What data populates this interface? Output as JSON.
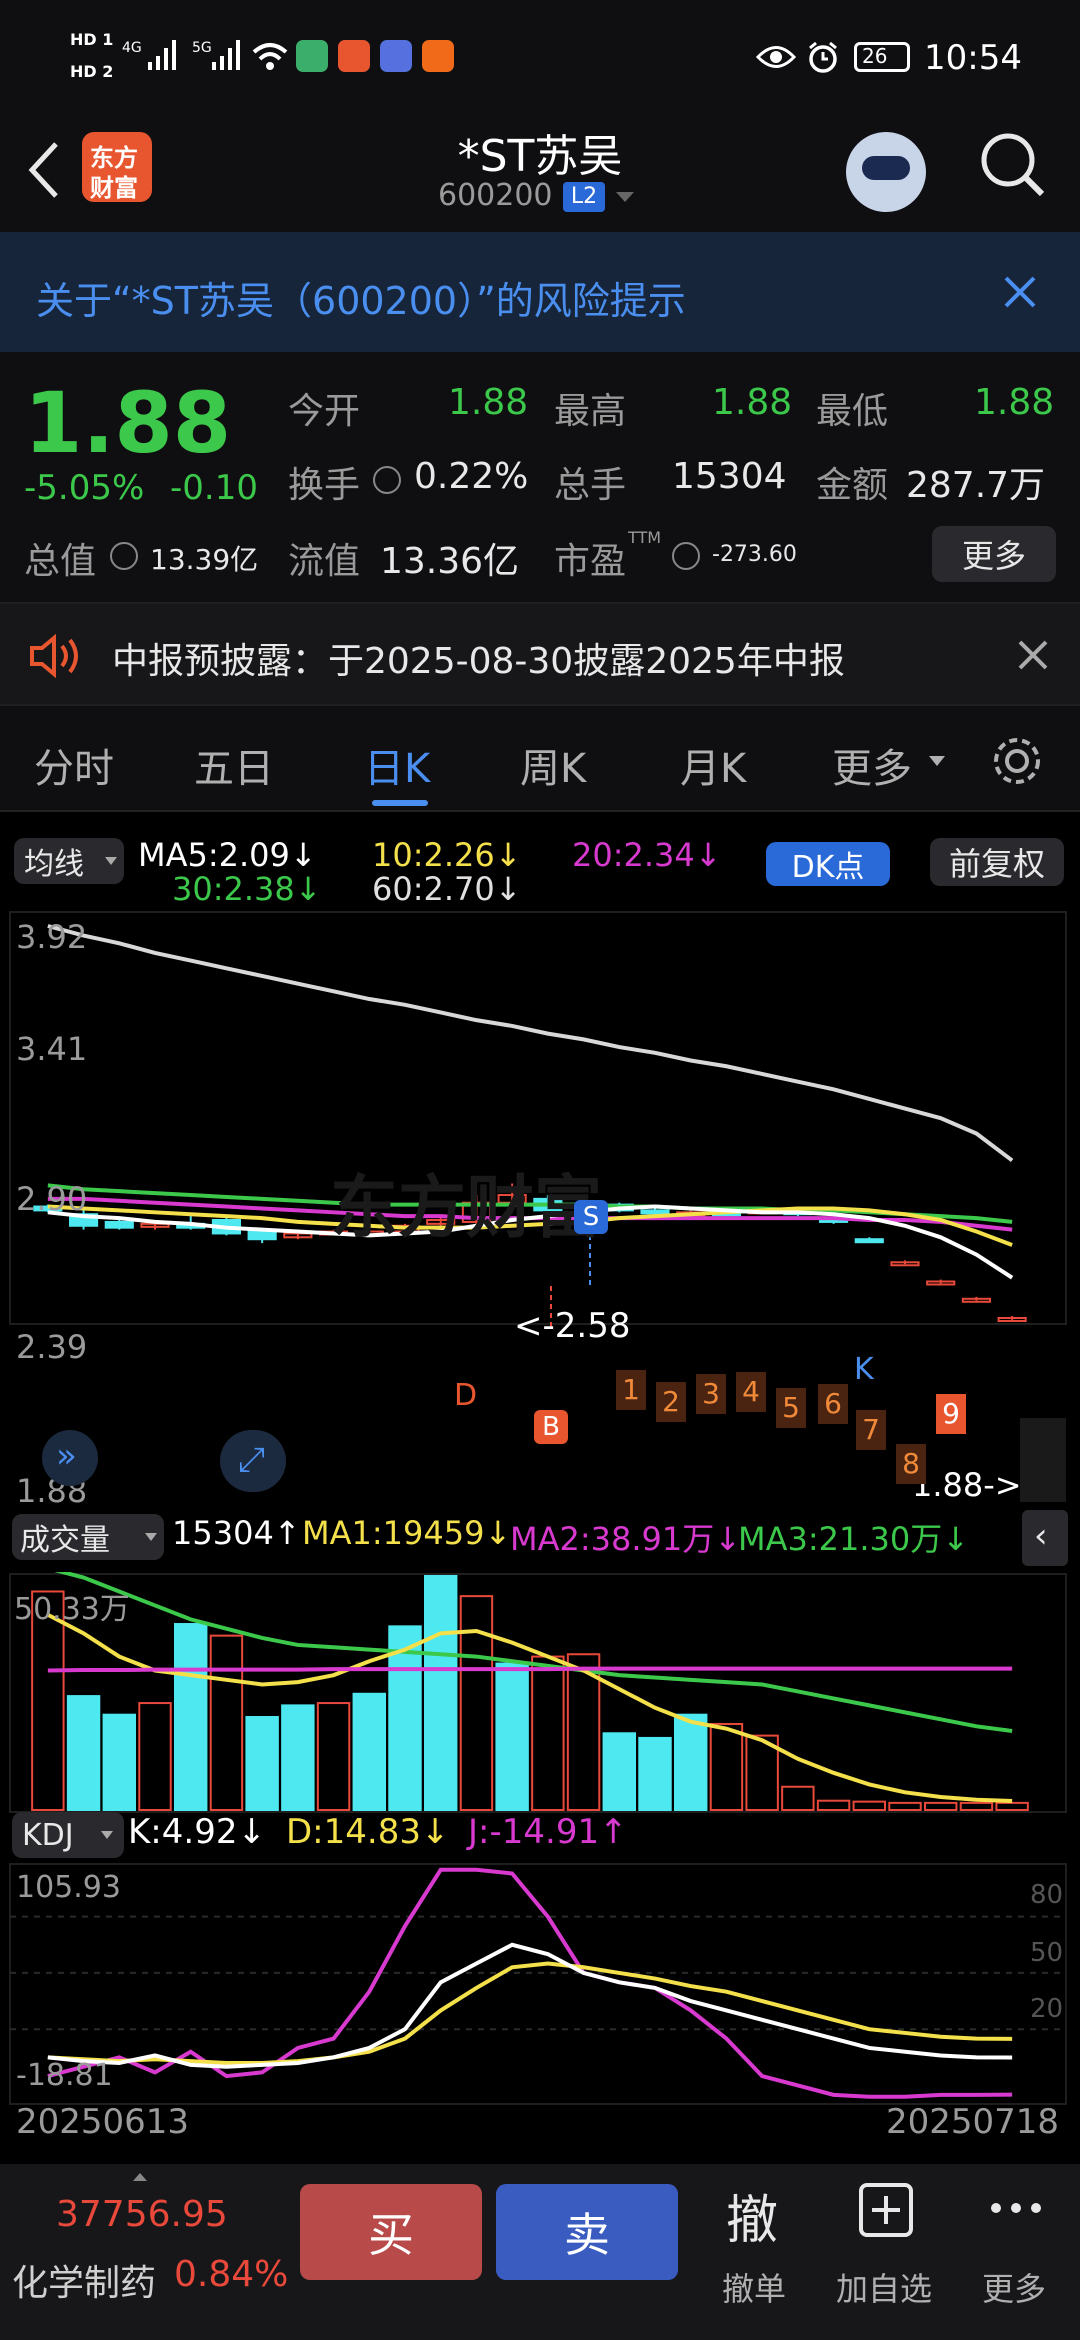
{
  "status": {
    "time": "10:54",
    "battery": "26",
    "sim1": "HD 1",
    "sim2": "HD 2",
    "net1": "4G",
    "net2": "5G"
  },
  "header": {
    "title": "*ST苏吴",
    "code": "600200",
    "level": "L2",
    "logo_top": "东方",
    "logo_bottom": "财富"
  },
  "risk_banner": {
    "text": "关于“*ST苏吴（600200）”的风险提示"
  },
  "quote": {
    "price": "1.88",
    "change_pct": "-5.05%",
    "change": "-0.10",
    "open_label": "今开",
    "open": "1.88",
    "high_label": "最高",
    "high": "1.88",
    "low_label": "最低",
    "low": "1.88",
    "turnover_label": "换手",
    "turnover": "0.22%",
    "volume_label": "总手",
    "volume": "15304",
    "amount_label": "金额",
    "amount": "287.7万",
    "mktcap_label": "总值",
    "mktcap": "13.39亿",
    "float_label": "流值",
    "float": "13.36亿",
    "pe_label": "市盈",
    "pe_sup": "TTM",
    "pe": "-273.60",
    "more": "更多"
  },
  "notice": {
    "text": "中报预披露：于2025-08-30披露2025年中报"
  },
  "tabs": [
    "分时",
    "五日",
    "日K",
    "周K",
    "月K",
    "更多"
  ],
  "active_tab": "日K",
  "ma_legend": {
    "selector": "均线",
    "ma5": "MA5:2.09↓",
    "ma10": "10:2.26↓",
    "ma20": "20:2.34↓",
    "ma30": "30:2.38↓",
    "ma60": "60:2.70↓",
    "dk": "DK点",
    "fq": "前复权"
  },
  "price_axis": [
    "3.92",
    "3.41",
    "2.90",
    "2.39",
    "1.88"
  ],
  "annotations": {
    "sell_marker": "S",
    "buy_marker": "B",
    "high_label": "<-2.58",
    "last_label": "1.88->",
    "d_label": "D",
    "k_label": "K",
    "nine_count": [
      "1",
      "2",
      "3",
      "4",
      "5",
      "6",
      "7",
      "8",
      "9"
    ]
  },
  "watermark": "东方财富",
  "volume_legend": {
    "selector": "成交量",
    "vol": "15304↑",
    "ma1": "MA1:19459↓",
    "ma2": "MA2:38.91万↓",
    "ma3": "MA3:21.30万↓",
    "axis_top": "50.33万"
  },
  "kdj_legend": {
    "selector": "KDJ",
    "k": "K:4.92↓",
    "d": "D:14.83↓",
    "j": "J:-14.91↑",
    "axis_top": "105.93",
    "axis_bottom": "-18.81",
    "lvl80": "80",
    "lvl50": "50",
    "lvl20": "20"
  },
  "date_range": {
    "start": "20250613",
    "end": "20250718"
  },
  "index_ticker": {
    "value": "37756.95",
    "name": "化学制药",
    "pct": "0.84%"
  },
  "bottom": {
    "buy": "买",
    "sell": "卖",
    "cancel_glyph": "撤",
    "cancel": "撤单",
    "watch": "加自选",
    "more": "更多"
  },
  "chart_data": {
    "type": "candlestick",
    "dates": {
      "start": "20250613",
      "end": "20250718"
    },
    "ylim": [
      1.88,
      3.92
    ],
    "candles": [
      {
        "o": 2.46,
        "c": 2.44,
        "h": 2.47,
        "l": 2.43
      },
      {
        "o": 2.42,
        "c": 2.36,
        "h": 2.44,
        "l": 2.34
      },
      {
        "o": 2.38,
        "c": 2.35,
        "h": 2.4,
        "l": 2.34
      },
      {
        "o": 2.36,
        "c": 2.37,
        "h": 2.39,
        "l": 2.34
      },
      {
        "o": 2.37,
        "c": 2.35,
        "h": 2.41,
        "l": 2.34
      },
      {
        "o": 2.39,
        "c": 2.32,
        "h": 2.4,
        "l": 2.31
      },
      {
        "o": 2.34,
        "c": 2.29,
        "h": 2.35,
        "l": 2.27
      },
      {
        "o": 2.3,
        "c": 2.32,
        "h": 2.33,
        "l": 2.29
      },
      {
        "o": 2.33,
        "c": 2.33,
        "h": 2.34,
        "l": 2.31
      },
      {
        "o": 2.32,
        "c": 2.33,
        "h": 2.34,
        "l": 2.31
      },
      {
        "o": 2.33,
        "c": 2.36,
        "h": 2.37,
        "l": 2.32
      },
      {
        "o": 2.37,
        "c": 2.39,
        "h": 2.41,
        "l": 2.36
      },
      {
        "o": 2.38,
        "c": 2.48,
        "h": 2.52,
        "l": 2.37
      },
      {
        "o": 2.48,
        "c": 2.52,
        "h": 2.58,
        "l": 2.46
      },
      {
        "o": 2.5,
        "c": 2.44,
        "h": 2.52,
        "l": 2.43
      },
      {
        "o": 2.46,
        "c": 2.47,
        "h": 2.49,
        "l": 2.44
      },
      {
        "o": 2.47,
        "c": 2.44,
        "h": 2.48,
        "l": 2.43
      },
      {
        "o": 2.44,
        "c": 2.43,
        "h": 2.45,
        "l": 2.42
      },
      {
        "o": 2.41,
        "c": 2.43,
        "h": 2.44,
        "l": 2.4
      },
      {
        "o": 2.43,
        "c": 2.42,
        "h": 2.44,
        "l": 2.41
      },
      {
        "o": 2.43,
        "c": 2.44,
        "h": 2.45,
        "l": 2.42
      },
      {
        "o": 2.44,
        "c": 2.42,
        "h": 2.45,
        "l": 2.41
      },
      {
        "o": 2.4,
        "c": 2.38,
        "h": 2.41,
        "l": 2.37
      },
      {
        "o": 2.29,
        "c": 2.28,
        "h": 2.3,
        "l": 2.27
      },
      {
        "o": 2.17,
        "c": 2.17,
        "h": 2.18,
        "l": 2.16
      },
      {
        "o": 2.07,
        "c": 2.07,
        "h": 2.08,
        "l": 2.06
      },
      {
        "o": 1.98,
        "c": 1.98,
        "h": 1.99,
        "l": 1.97
      },
      {
        "o": 1.88,
        "c": 1.88,
        "h": 1.89,
        "l": 1.87
      }
    ],
    "ma5": [
      2.43,
      2.41,
      2.4,
      2.38,
      2.37,
      2.35,
      2.34,
      2.33,
      2.32,
      2.31,
      2.32,
      2.33,
      2.36,
      2.39,
      2.41,
      2.43,
      2.45,
      2.46,
      2.45,
      2.44,
      2.43,
      2.43,
      2.42,
      2.4,
      2.36,
      2.3,
      2.21,
      2.09
    ],
    "ma10": [
      2.46,
      2.45,
      2.44,
      2.43,
      2.42,
      2.41,
      2.4,
      2.38,
      2.37,
      2.36,
      2.35,
      2.35,
      2.35,
      2.36,
      2.37,
      2.38,
      2.4,
      2.41,
      2.42,
      2.43,
      2.44,
      2.45,
      2.45,
      2.44,
      2.42,
      2.39,
      2.33,
      2.26
    ],
    "ma20": [
      2.5,
      2.5,
      2.49,
      2.48,
      2.47,
      2.46,
      2.45,
      2.44,
      2.43,
      2.42,
      2.41,
      2.41,
      2.4,
      2.4,
      2.4,
      2.4,
      2.4,
      2.4,
      2.4,
      2.4,
      2.4,
      2.4,
      2.4,
      2.39,
      2.39,
      2.38,
      2.36,
      2.34
    ],
    "ma30": [
      2.57,
      2.55,
      2.54,
      2.53,
      2.52,
      2.51,
      2.5,
      2.49,
      2.48,
      2.47,
      2.47,
      2.47,
      2.47,
      2.47,
      2.47,
      2.47,
      2.46,
      2.46,
      2.45,
      2.45,
      2.45,
      2.44,
      2.44,
      2.43,
      2.42,
      2.41,
      2.4,
      2.38
    ],
    "ma60": [
      3.92,
      3.87,
      3.83,
      3.78,
      3.74,
      3.7,
      3.66,
      3.62,
      3.58,
      3.54,
      3.51,
      3.47,
      3.43,
      3.4,
      3.36,
      3.33,
      3.29,
      3.26,
      3.22,
      3.19,
      3.15,
      3.11,
      3.07,
      3.02,
      2.97,
      2.92,
      2.84,
      2.7
    ],
    "volume": {
      "ylim": [
        0,
        503300
      ],
      "values": [
        470000,
        245000,
        205000,
        230000,
        400000,
        375000,
        200000,
        225000,
        230000,
        250000,
        395000,
        503300,
        460000,
        315000,
        330000,
        335000,
        165000,
        155000,
        205000,
        185000,
        160000,
        50000,
        20000,
        18000,
        15304,
        15304,
        15304,
        15304
      ],
      "up": [
        true,
        false,
        false,
        true,
        false,
        true,
        false,
        false,
        true,
        false,
        false,
        false,
        true,
        false,
        true,
        true,
        false,
        false,
        false,
        true,
        true,
        true,
        true,
        true,
        true,
        true,
        true,
        true
      ]
    },
    "vol_ma1": [
      420000,
      380000,
      330000,
      300000,
      290000,
      280000,
      270000,
      275000,
      290000,
      320000,
      345000,
      380000,
      385000,
      360000,
      330000,
      300000,
      260000,
      220000,
      190000,
      175000,
      150000,
      110000,
      80000,
      55000,
      38000,
      28000,
      22000,
      19459
    ],
    "vol_ma2": [
      520000,
      500000,
      470000,
      440000,
      410000,
      390000,
      370000,
      355000,
      350000,
      345000,
      340000,
      335000,
      330000,
      320000,
      310000,
      300000,
      290000,
      285000,
      280000,
      275000,
      270000,
      255000,
      240000,
      225000,
      210000,
      195000,
      180000,
      170000
    ],
    "vol_ma3": [
      300000,
      301000,
      301000,
      302000,
      302000,
      302000,
      302000,
      302000,
      303000,
      303000,
      303000,
      303000,
      303000,
      303000,
      303000,
      304000,
      304000,
      304000,
      304000,
      304000,
      304000,
      304000,
      304000,
      304000,
      304000,
      304000,
      304000,
      304000
    ],
    "kdj": {
      "ylim": [
        -18.81,
        105.93
      ],
      "k": [
        5,
        3,
        2,
        6,
        1,
        0,
        1,
        2,
        5,
        10,
        20,
        45,
        55,
        65,
        60,
        50,
        45,
        42,
        35,
        30,
        25,
        20,
        15,
        10,
        8,
        6,
        5,
        4.92
      ],
      "d": [
        5,
        4,
        3,
        4,
        3,
        2,
        2,
        3,
        5,
        8,
        15,
        30,
        42,
        53,
        55,
        53,
        50,
        47,
        43,
        40,
        35,
        30,
        25,
        20,
        18,
        16,
        15,
        14.83
      ],
      "j": [
        -5,
        0,
        5,
        -3,
        8,
        -5,
        -3,
        10,
        15,
        40,
        75,
        105,
        105,
        103,
        80,
        50,
        45,
        42,
        30,
        15,
        -5,
        -10,
        -15,
        -16,
        -16,
        -15,
        -15,
        -14.91
      ]
    }
  }
}
